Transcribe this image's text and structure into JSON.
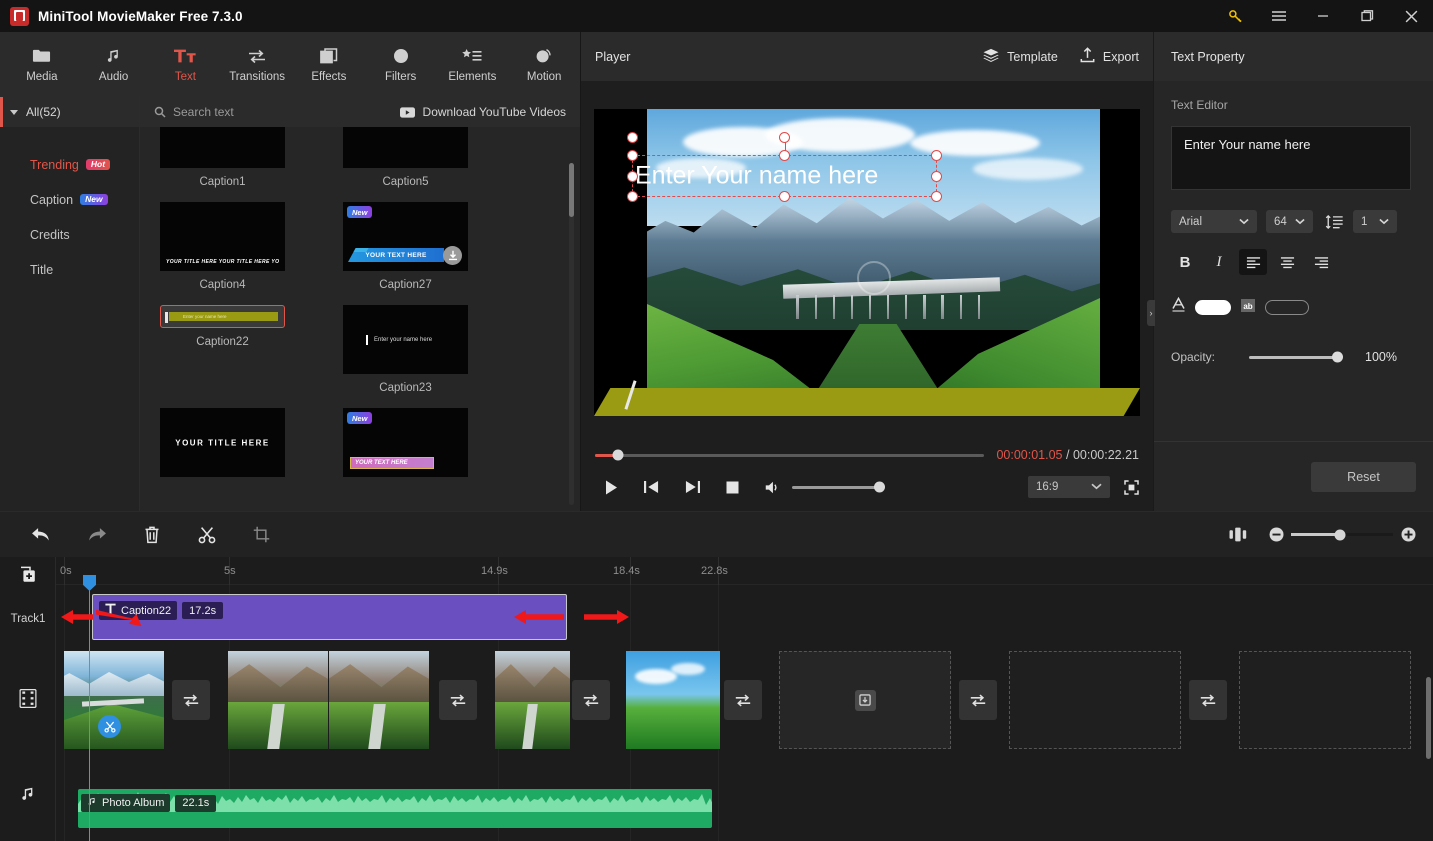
{
  "window": {
    "title": "MiniTool MovieMaker Free 7.3.0",
    "controls": {
      "key": "key-icon",
      "menu": "menu-icon",
      "minimize": "minimize-icon",
      "maximize": "maximize-icon",
      "close": "close-icon"
    }
  },
  "ribbon": {
    "items": [
      {
        "label": "Media",
        "icon": "folder-icon",
        "active": false
      },
      {
        "label": "Audio",
        "icon": "music-note-icon",
        "active": false
      },
      {
        "label": "Text",
        "icon": "text-tt-icon",
        "active": true
      },
      {
        "label": "Transitions",
        "icon": "transition-arrows-icon",
        "active": false
      },
      {
        "label": "Effects",
        "icon": "effects-squares-icon",
        "active": false
      },
      {
        "label": "Filters",
        "icon": "filters-drop-icon",
        "active": false
      },
      {
        "label": "Elements",
        "icon": "elements-star-list-icon",
        "active": false
      },
      {
        "label": "Motion",
        "icon": "motion-circles-icon",
        "active": false
      }
    ]
  },
  "library": {
    "all_label": "All(52)",
    "categories": [
      {
        "label": "Trending",
        "badge": "Hot",
        "badge_type": "hot",
        "active": true
      },
      {
        "label": "Caption",
        "badge": "New",
        "badge_type": "new",
        "active": false
      },
      {
        "label": "Credits",
        "badge": "",
        "badge_type": "",
        "active": false
      },
      {
        "label": "Title",
        "badge": "",
        "badge_type": "",
        "active": false
      }
    ],
    "search_placeholder": "Search text",
    "download_youtube_label": "Download YouTube Videos",
    "thumbnails": [
      {
        "name": "Caption1",
        "style": "blank",
        "badge": "",
        "selected": false,
        "preview_text": ""
      },
      {
        "name": "Caption5",
        "style": "blank",
        "badge": "",
        "selected": false,
        "preview_text": ""
      },
      {
        "name": "Caption4",
        "style": "tinyline",
        "badge": "",
        "selected": false,
        "preview_text": "YOUR TITLE HERE YOUR TITLE HERE YOUR TITLE"
      },
      {
        "name": "Caption27",
        "style": "blueband",
        "badge": "New",
        "selected": false,
        "preview_text": "YOUR TEXT HERE",
        "downloadable": true
      },
      {
        "name": "Caption22",
        "style": "yellowband",
        "badge": "",
        "selected": true,
        "preview_text": "Enter your name here"
      },
      {
        "name": "Caption23",
        "style": "plaintext",
        "badge": "",
        "selected": false,
        "preview_text": "Enter your name here"
      },
      {
        "name": "",
        "style": "bigtitle",
        "badge": "",
        "selected": false,
        "preview_text": "YOUR TITLE HERE"
      },
      {
        "name": "",
        "style": "pinkband",
        "badge": "New",
        "selected": false,
        "preview_text": "YOUR TEXT HERE"
      }
    ]
  },
  "player": {
    "title": "Player",
    "template_label": "Template",
    "export_label": "Export",
    "overlay_text": "Enter Your name here",
    "current_time": "00:00:01.05",
    "separator": "/",
    "total_time": "00:00:22.21",
    "aspect_ratio": "16:9",
    "progress_percent": 6,
    "volume_percent": 100,
    "buttons": {
      "play": "play-icon",
      "prev_frame": "previous-frame-icon",
      "next_frame": "next-frame-icon",
      "stop": "stop-icon",
      "volume": "volume-icon",
      "fullscreen": "fullscreen-icon"
    }
  },
  "text_property": {
    "panel_title": "Text Property",
    "section_label": "Text Editor",
    "editor_value": "Enter Your name here",
    "font_family": "Arial",
    "font_size": "64",
    "line_spacing": "1",
    "line_spacing_icon": "line-height-icon",
    "bold_label": "B",
    "italic_label": "I",
    "align_left_icon": "align-left-icon",
    "align_center_icon": "align-center-icon",
    "align_right_icon": "align-right-icon",
    "align_active": "left",
    "text_color_icon": "font-color-icon",
    "text_color": "#ffffff",
    "highlight_icon": "highlight-ab-icon",
    "highlight_color": "none",
    "opacity_label": "Opacity:",
    "opacity_value": "100%",
    "opacity_percent": 100,
    "reset_label": "Reset"
  },
  "timeline": {
    "toolbar": [
      {
        "name": "undo-button",
        "icon": "undo-arrow-icon",
        "enabled": true
      },
      {
        "name": "redo-button",
        "icon": "redo-arrow-icon",
        "enabled": false
      },
      {
        "name": "delete-button",
        "icon": "trash-icon",
        "enabled": true
      },
      {
        "name": "split-button",
        "icon": "scissors-icon",
        "enabled": true
      },
      {
        "name": "crop-button",
        "icon": "crop-icon",
        "enabled": false
      }
    ],
    "zoom": {
      "split_view_icon": "split-view-icon",
      "minus": "minus-icon",
      "plus": "plus-icon",
      "value_percent": 48
    },
    "ruler_labels": [
      "0s",
      "5s",
      "14.9s",
      "18.4s",
      "22.8s"
    ],
    "ruler_positions": [
      0,
      165,
      434,
      566,
      654
    ],
    "gutter": {
      "add_track_icon": "add-track-icon",
      "track1_label": "Track1",
      "video_track_icon": "film-strip-icon",
      "audio_track_icon": "music-note-icon"
    },
    "text_clip": {
      "icon": "text-t-icon",
      "name": "Caption22",
      "duration": "17.2s"
    },
    "audio_clip": {
      "icon": "music-note-icon",
      "name": "Photo Album",
      "duration": "22.1s"
    },
    "split_marker_icon": "scissors-circle-icon",
    "transition_icon": "transition-arrows-icon",
    "placeholder_icon": "download-box-icon",
    "annotation_arrow_color": "#f01818"
  }
}
